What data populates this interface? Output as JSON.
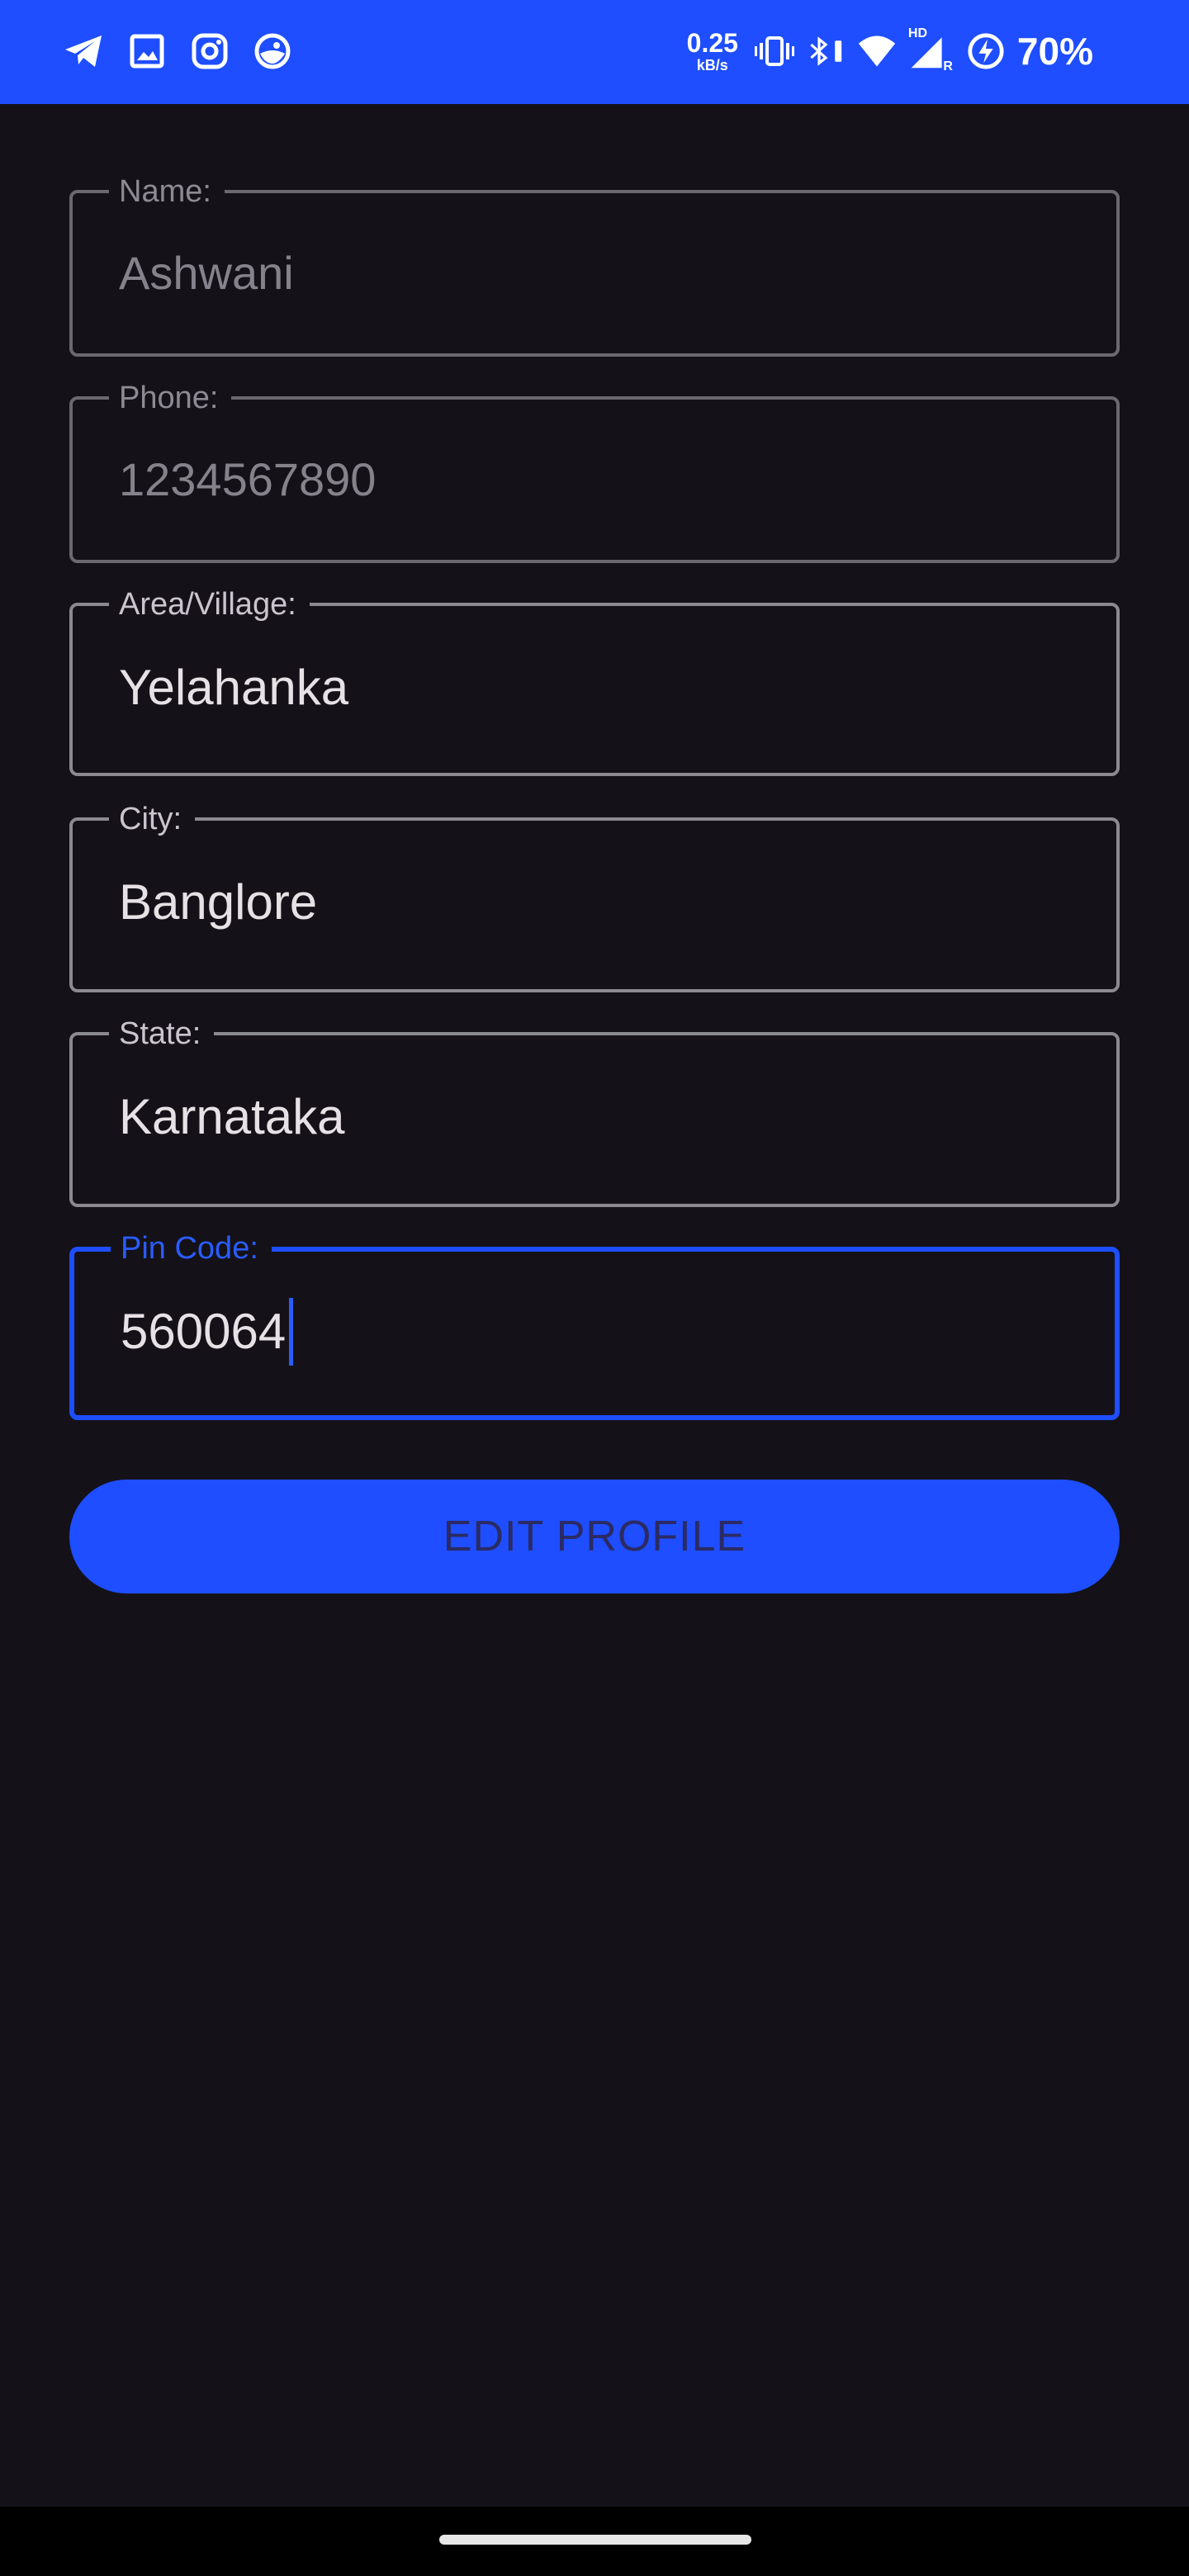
{
  "status_bar": {
    "left_icons": [
      "telegram-icon",
      "gallery-icon",
      "instagram-icon",
      "app-icon"
    ],
    "net_speed_value": "0.25",
    "net_speed_unit": "kB/s",
    "hd_label": "HD",
    "roaming_label": "R",
    "battery_percent": "70%",
    "background_color": "#1e4eff"
  },
  "form": {
    "name": {
      "label": "Name:",
      "value": "Ashwani"
    },
    "phone": {
      "label": "Phone:",
      "value": "1234567890"
    },
    "area": {
      "label": "Area/Village:",
      "value": "Yelahanka"
    },
    "city": {
      "label": "City:",
      "value": "Banglore"
    },
    "state": {
      "label": "State:",
      "value": "Karnataka"
    },
    "pincode": {
      "label": "Pin Code:",
      "value": "560064"
    }
  },
  "edit_button_label": "EDIT PROFILE",
  "colors": {
    "accent": "#1e4eff",
    "background": "#141218",
    "outline": "#8c8a91"
  }
}
